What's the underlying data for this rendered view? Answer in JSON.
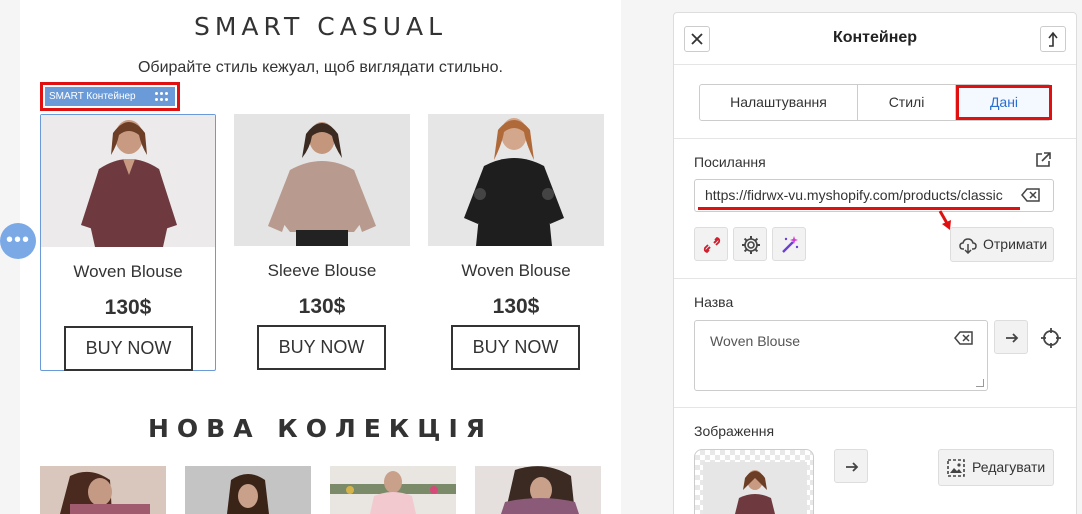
{
  "canvas": {
    "title": "SMART CASUAL",
    "subtitle": "Обирайте стиль кежуал, щоб виглядати стильно.",
    "smart_label": "SMART Контейнер",
    "products": [
      {
        "name": "Woven Blouse",
        "price": "130$",
        "button": "BUY NOW",
        "image": "woman-maroon-blouse",
        "selected": true
      },
      {
        "name": "Sleeve Blouse",
        "price": "130$",
        "button": "BUY NOW",
        "image": "woman-beige-blouse",
        "selected": false
      },
      {
        "name": "Woven Blouse",
        "price": "130$",
        "button": "BUY NOW",
        "image": "woman-black-lace-blouse",
        "selected": false
      }
    ],
    "collection_title": "НОВА КОЛЕКЦІЯ",
    "side_handle": "•••"
  },
  "panel": {
    "title": "Контейнер",
    "tabs": [
      {
        "label": "Налаштування",
        "active": false
      },
      {
        "label": "Стилі",
        "active": false
      },
      {
        "label": "Дані",
        "active": true
      }
    ],
    "link_section": {
      "label": "Посилання",
      "url": "https://fidrwx-vu.myshopify.com/products/classic",
      "fetch_label": "Отримати"
    },
    "name_section": {
      "label": "Назва",
      "value": "Woven Blouse"
    },
    "image_section": {
      "label": "Зображення",
      "edit_label": "Редагувати"
    }
  },
  "colors": {
    "accent_blue": "#2a6fd0",
    "highlight_red": "#e01010",
    "selection_blue": "#6a9bd8"
  }
}
